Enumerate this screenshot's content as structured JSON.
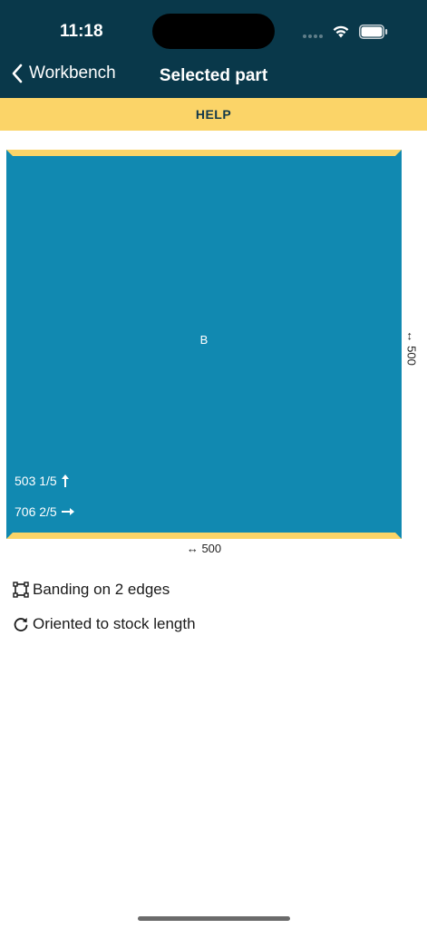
{
  "status_bar": {
    "time": "11:18"
  },
  "nav": {
    "back_label": "Workbench",
    "title": "Selected part"
  },
  "help": {
    "label": "HELP"
  },
  "part": {
    "label": "B",
    "dimension_1": "503 1/5",
    "dimension_2": "706 2/5",
    "side_width": "↔ 500",
    "bottom_width": "↔ 500",
    "panel_color": "#1189b1",
    "banding_color": "#fbd468"
  },
  "info": {
    "banding": "Banding on 2 edges",
    "orientation": "Oriented to stock length"
  },
  "icons": {
    "back": "chevron-left-icon",
    "wifi": "wifi-icon",
    "battery": "battery-icon",
    "arrow_up": "arrow-up-icon",
    "arrow_right": "arrow-right-icon",
    "banding": "banding-square-icon",
    "rotate": "rotate-clockwise-icon"
  }
}
